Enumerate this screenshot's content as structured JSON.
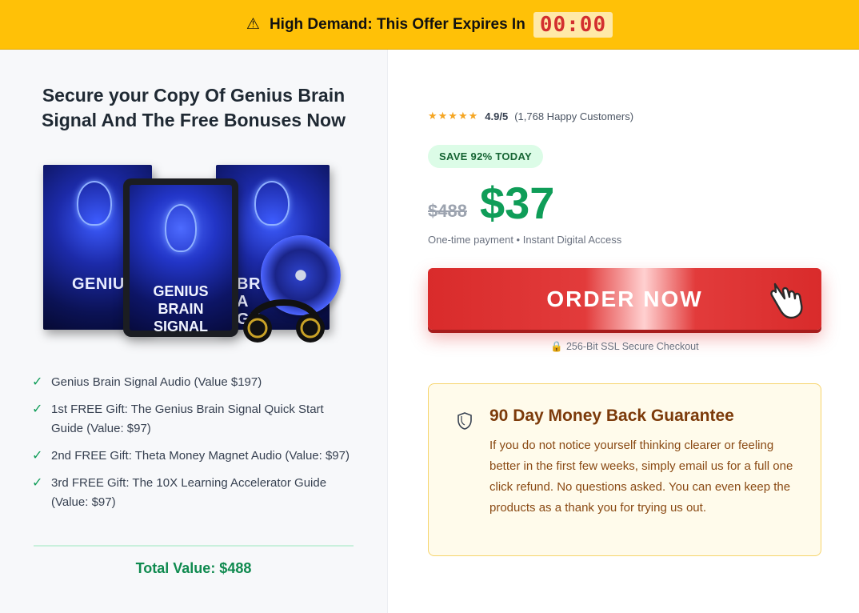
{
  "banner": {
    "warning_icon": "warning-triangle-icon",
    "text": "High Demand: This Offer Expires In",
    "timer": "00:00"
  },
  "left": {
    "headline": "Secure your Copy Of Genius Brain Signal And The Free Bonuses Now",
    "product": {
      "box_label_left": "GENIUS",
      "box_label_right": "BRA GE",
      "tablet_title": "GENIUS BRAIN SIGNAL"
    },
    "checklist": [
      "Genius Brain Signal Audio (Value $197)",
      "1st FREE Gift: The Genius Brain Signal Quick Start Guide (Value: $97)",
      "2nd FREE Gift: Theta Money Magnet Audio (Value: $97)",
      "3rd FREE Gift: The 10X Learning Accelerator Guide (Value: $97)"
    ],
    "check_glyph": "✓",
    "total": "Total Value: $488"
  },
  "right": {
    "rating": {
      "stars": "★★★★★",
      "score": "4.9/5",
      "customers": "(1,768 Happy Customers)"
    },
    "save_badge": "SAVE 92% TODAY",
    "old_price": "$488",
    "new_price": "$37",
    "payment_note": "One-time payment • Instant Digital Access",
    "order_button": "ORDER NOW",
    "ssl_text": "256-Bit SSL Secure Checkout",
    "guarantee": {
      "title": "90 Day Money Back Guarantee",
      "body": "If you do not notice yourself thinking clearer or feeling better in the first few weeks, simply email us for a full one click refund. No questions asked. You can even keep the products as a thank you for trying us out."
    }
  },
  "colors": {
    "banner_bg": "#ffc107",
    "accent_green": "#0f9d58",
    "order_red": "#e23b3b",
    "guarantee_bg": "#fffbeb"
  }
}
